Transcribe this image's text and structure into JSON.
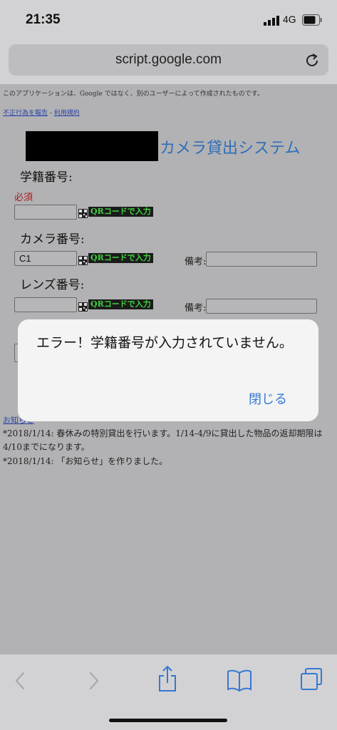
{
  "status": {
    "time": "21:35",
    "network": "4G"
  },
  "browser": {
    "url": "script.google.com"
  },
  "page": {
    "notice": "このアプリケーションは、Google ではなく、別のユーザーによって作成されたものです。",
    "report_link": "不正行為を報告",
    "separator": " - ",
    "terms_link": "利用規約",
    "title": "カメラ貸出システム",
    "student_label": "学籍番号:",
    "required": "必須",
    "qr_button": "QRコードで入力",
    "camera_label": "カメラ番号:",
    "camera_value": "C1",
    "biko_label": "備考:",
    "lens_label": "レンズ番号:",
    "news_link": "お知らせ",
    "news_items": [
      "*2018/1/14: 春休みの特別貸出を行います。1/14-4/9に貸出した物品の返却期限は4/10までになります。",
      "*2018/1/14: 「お知らせ」を作りました。"
    ]
  },
  "alert": {
    "message": "エラー！学籍番号が入力されていません。",
    "close_label": "閉じる"
  },
  "colors": {
    "accent": "#3478d4",
    "title": "#2f6fb8",
    "required": "#b01818",
    "qr_text": "#3fd23f"
  }
}
